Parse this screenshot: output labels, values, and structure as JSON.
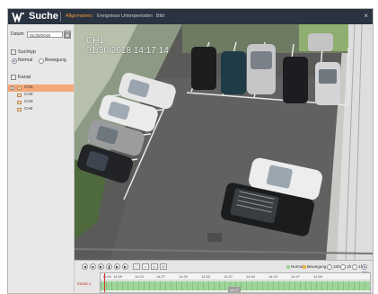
{
  "titlebar": {
    "title": "Suche",
    "tabs": [
      {
        "label": "Allgemeines",
        "active": true
      },
      {
        "label": "Ereignisse",
        "active": false
      },
      {
        "label": "Unterperioden",
        "active": false
      },
      {
        "label": "Bild",
        "active": false
      }
    ],
    "close": "×"
  },
  "sidebar": {
    "date_label": "Datum",
    "date_value": "01/30/2018",
    "type_title": "Suchtyp",
    "type_options": [
      {
        "label": "Normal",
        "selected": true
      },
      {
        "label": "Bewegung",
        "selected": false
      }
    ],
    "channel_title": "Kanal",
    "channels": [
      {
        "label": "CH1",
        "selected": true
      },
      {
        "label": "CH2",
        "selected": false
      },
      {
        "label": "CH3",
        "selected": false
      },
      {
        "label": "CH4",
        "selected": false
      }
    ]
  },
  "video": {
    "channel": "CH1",
    "timestamp": "01/30/2018  14:17:14"
  },
  "playback": {
    "legend_normal": "Normal",
    "legend_motion": "Bewegung",
    "zoom_options": [
      "24h",
      "2h",
      "1h",
      "30m"
    ],
    "cursor_time": "14:17",
    "channel_label": "Kanal 1",
    "ticks": [
      "14:00",
      "14:09",
      "14:23",
      "14:27",
      "14:30",
      "14:33",
      "14:37",
      "14:40",
      "14:43",
      "14:47",
      "14:50"
    ]
  },
  "colors": {
    "titlebar": "#2a3340",
    "accent": "#f39a3a",
    "selection": "#f4a878",
    "record_normal": "#9fd59a",
    "record_motion": "#e9b64a"
  }
}
